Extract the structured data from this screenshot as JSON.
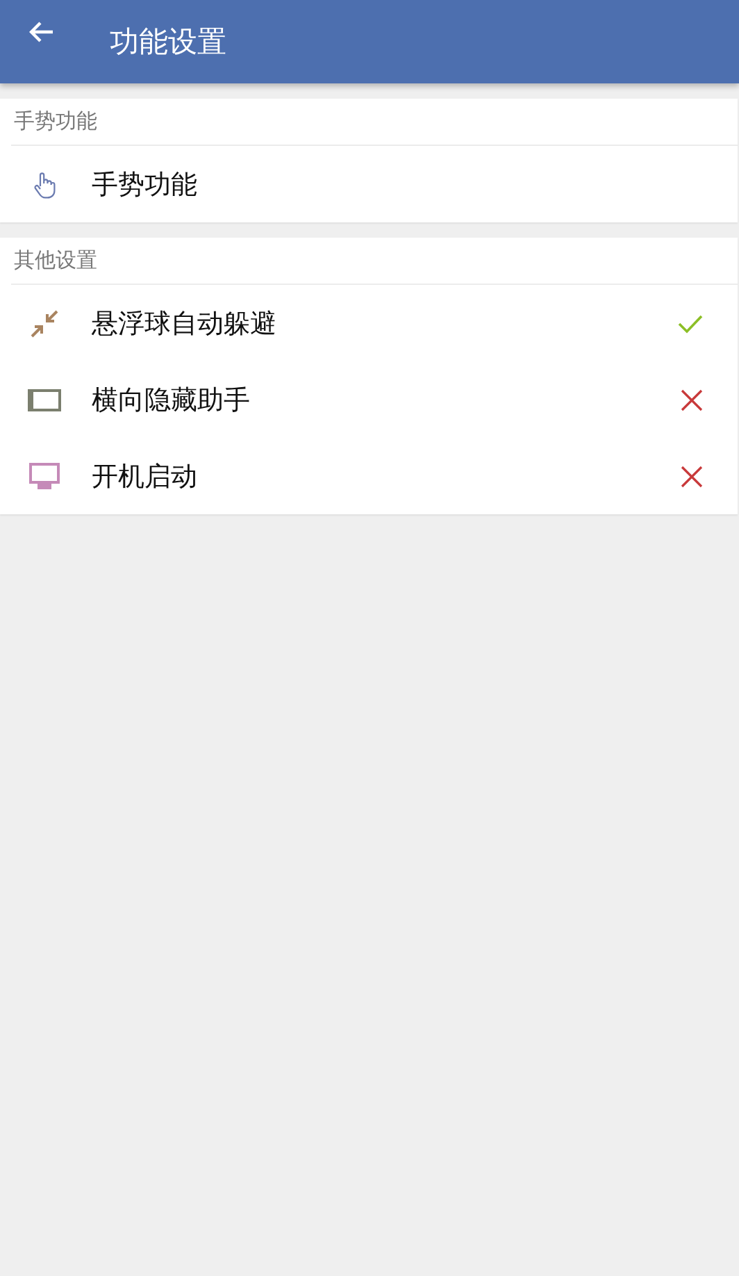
{
  "app_bar": {
    "title": "功能设置"
  },
  "sections": [
    {
      "header": "手势功能",
      "items": [
        {
          "label": "手势功能",
          "kind": "link"
        }
      ]
    },
    {
      "header": "其他设置",
      "items": [
        {
          "label": "悬浮球自动躲避",
          "kind": "toggle",
          "on": true
        },
        {
          "label": "横向隐藏助手",
          "kind": "toggle",
          "on": false
        },
        {
          "label": "开机启动",
          "kind": "toggle",
          "on": false
        }
      ]
    }
  ]
}
